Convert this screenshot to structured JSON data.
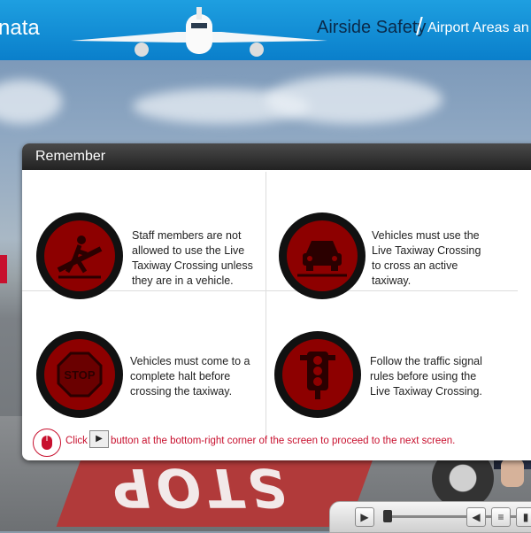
{
  "header": {
    "logo_text": "nata",
    "course_title": "Airside Safety",
    "section_title": "Airport Areas an"
  },
  "panel": {
    "title": "Remember",
    "items": [
      {
        "text": "Staff members are not allowed to use the Live Taxiway Crossing unless they are in a vehicle.",
        "icon": "no-pedestrian-icon"
      },
      {
        "text": "Vehicles must use the Live Taxiway Crossing to cross an active taxiway.",
        "icon": "vehicle-icon"
      },
      {
        "text": "Vehicles must come to a complete halt before crossing the taxiway.",
        "icon": "stop-sign-icon"
      },
      {
        "text": "Follow the traffic signal rules before using the Live Taxiway Crossing.",
        "icon": "traffic-light-icon"
      }
    ],
    "footer": {
      "click_label": "Click",
      "instruction": "button at the bottom-right corner of the screen to proceed to the next screen."
    }
  },
  "background": {
    "stop_marking": "STOP"
  },
  "stop_sign_label": "STOP",
  "colors": {
    "accent_red": "#c8102e",
    "icon_red": "#8d0000",
    "header_blue": "#0a7fcb"
  }
}
